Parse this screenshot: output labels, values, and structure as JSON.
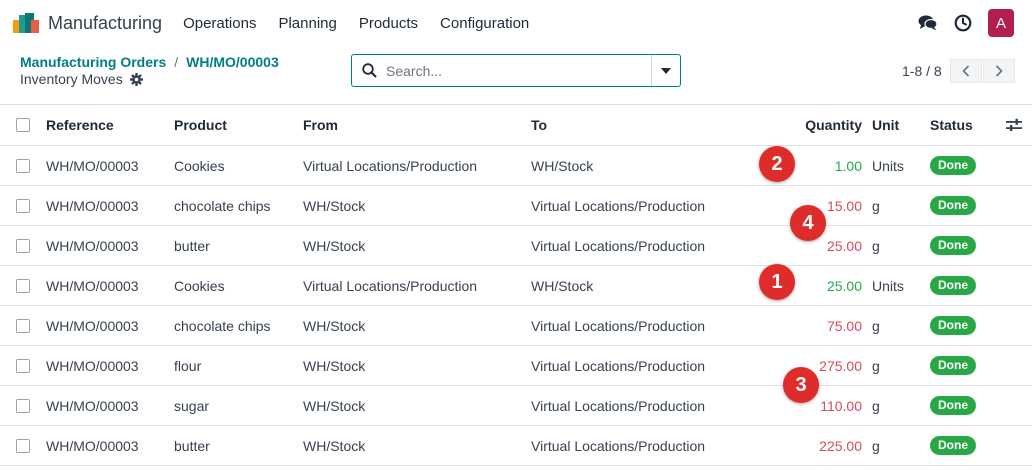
{
  "app": {
    "name": "Manufacturing"
  },
  "menu": [
    "Operations",
    "Planning",
    "Products",
    "Configuration"
  ],
  "nav_icons": {
    "chat": "chat-icon",
    "activity": "clock-icon"
  },
  "user": {
    "initial": "A",
    "color": "#b21e4d"
  },
  "breadcrumb": {
    "parent": "Manufacturing Orders",
    "separator": "/",
    "current": "WH/MO/00003"
  },
  "view_title": "Inventory Moves",
  "search": {
    "placeholder": "Search..."
  },
  "pager": {
    "value": "1-8 / 8"
  },
  "columns": {
    "reference": "Reference",
    "product": "Product",
    "from": "From",
    "to": "To",
    "quantity": "Quantity",
    "unit": "Unit",
    "status": "Status"
  },
  "colors": {
    "accent": "#017e84",
    "done_badge": "#28a745",
    "qty_in": "#28a745",
    "qty_out": "#d44c59",
    "marker": "#e02b2b"
  },
  "rows": [
    {
      "reference": "WH/MO/00003",
      "product": "Cookies",
      "from": "Virtual Locations/Production",
      "to": "WH/Stock",
      "quantity": "1.00",
      "unit": "Units",
      "status": "Done",
      "direction": "in"
    },
    {
      "reference": "WH/MO/00003",
      "product": "chocolate chips",
      "from": "WH/Stock",
      "to": "Virtual Locations/Production",
      "quantity": "15.00",
      "unit": "g",
      "status": "Done",
      "direction": "out"
    },
    {
      "reference": "WH/MO/00003",
      "product": "butter",
      "from": "WH/Stock",
      "to": "Virtual Locations/Production",
      "quantity": "25.00",
      "unit": "g",
      "status": "Done",
      "direction": "out"
    },
    {
      "reference": "WH/MO/00003",
      "product": "Cookies",
      "from": "Virtual Locations/Production",
      "to": "WH/Stock",
      "quantity": "25.00",
      "unit": "Units",
      "status": "Done",
      "direction": "in"
    },
    {
      "reference": "WH/MO/00003",
      "product": "chocolate chips",
      "from": "WH/Stock",
      "to": "Virtual Locations/Production",
      "quantity": "75.00",
      "unit": "g",
      "status": "Done",
      "direction": "out"
    },
    {
      "reference": "WH/MO/00003",
      "product": "flour",
      "from": "WH/Stock",
      "to": "Virtual Locations/Production",
      "quantity": "275.00",
      "unit": "g",
      "status": "Done",
      "direction": "out"
    },
    {
      "reference": "WH/MO/00003",
      "product": "sugar",
      "from": "WH/Stock",
      "to": "Virtual Locations/Production",
      "quantity": "110.00",
      "unit": "g",
      "status": "Done",
      "direction": "out"
    },
    {
      "reference": "WH/MO/00003",
      "product": "butter",
      "from": "WH/Stock",
      "to": "Virtual Locations/Production",
      "quantity": "225.00",
      "unit": "g",
      "status": "Done",
      "direction": "out"
    }
  ],
  "markers": [
    "2",
    "4",
    "1",
    "3"
  ]
}
